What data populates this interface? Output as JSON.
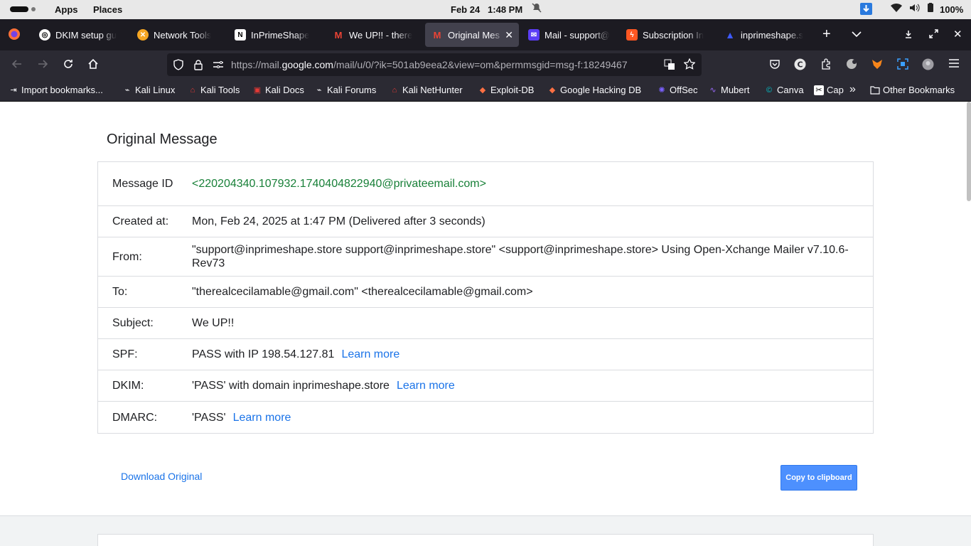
{
  "topbar": {
    "apps": "Apps",
    "places": "Places",
    "date": "Feb 24",
    "time": "1:48 PM",
    "battery": "100%"
  },
  "tabs": [
    {
      "label": "DKIM setup gu",
      "favicon": "openai-icon",
      "color": "#ffffff"
    },
    {
      "label": "Network Tools",
      "favicon": "network-tools-icon",
      "color": "#f5a623"
    },
    {
      "label": "InPrimeShape",
      "favicon": "notion-icon",
      "color": "#ffffff"
    },
    {
      "label": "We UP!! - there",
      "favicon": "gmail-icon",
      "color": "#ea4335"
    },
    {
      "label": "Original Mes",
      "favicon": "gmail-icon",
      "color": "#ea4335"
    },
    {
      "label": "Mail - support@",
      "favicon": "mail-icon",
      "color": "#5b3df5"
    },
    {
      "label": "Subscription In",
      "favicon": "subscription-icon",
      "color": "#ff5722"
    },
    {
      "label": "inprimeshape.s",
      "favicon": "triangle-icon",
      "color": "#3d5afe"
    }
  ],
  "url": {
    "prefix": "https://mail.",
    "host": "google.com",
    "rest": "/mail/u/0/?ik=501ab9eea2&view=om&permmsgid=msg-f:18249467"
  },
  "bookmarks": [
    {
      "label": "Import bookmarks...",
      "icon": "import-icon"
    },
    {
      "label": "Kali Linux",
      "icon": "kali-icon"
    },
    {
      "label": "Kali Tools",
      "icon": "kali-tools-icon"
    },
    {
      "label": "Kali Docs",
      "icon": "kali-docs-icon"
    },
    {
      "label": "Kali Forums",
      "icon": "kali-forums-icon"
    },
    {
      "label": "Kali NetHunter",
      "icon": "nethunter-icon"
    },
    {
      "label": "Exploit-DB",
      "icon": "exploit-db-icon"
    },
    {
      "label": "Google Hacking DB",
      "icon": "ghdb-icon"
    },
    {
      "label": "OffSec",
      "icon": "offsec-icon"
    },
    {
      "label": "Mubert",
      "icon": "mubert-icon"
    },
    {
      "label": "Canva",
      "icon": "canva-icon"
    },
    {
      "label": "Cap",
      "icon": "capcut-icon"
    },
    {
      "label": "Other Bookmarks",
      "icon": "folder-icon"
    }
  ],
  "page": {
    "title": "Original Message",
    "rows": {
      "message_id": {
        "key": "Message ID",
        "value": "<220204340.107932.1740404822940@privateemail.com>"
      },
      "created": {
        "key": "Created at:",
        "value": "Mon, Feb 24, 2025 at 1:47 PM (Delivered after 3 seconds)"
      },
      "from": {
        "key": "From:",
        "value": "\"support@inprimeshape.store support@inprimeshape.store\" <support@inprimeshape.store> Using Open-Xchange Mailer v7.10.6-Rev73"
      },
      "to": {
        "key": "To:",
        "value": "\"therealcecilamable@gmail.com\" <therealcecilamable@gmail.com>"
      },
      "subject": {
        "key": "Subject:",
        "value": "We UP!!"
      },
      "spf": {
        "key": "SPF:",
        "value": "PASS with IP 198.54.127.81",
        "link": "Learn more"
      },
      "dkim": {
        "key": "DKIM:",
        "value": "'PASS' with domain inprimeshape.store",
        "link": "Learn more"
      },
      "dmarc": {
        "key": "DMARC:",
        "value": "'PASS'",
        "link": "Learn more"
      }
    },
    "download_label": "Download Original",
    "copy_label": "Copy to clipboard"
  },
  "colors": {
    "link": "#1a73e8",
    "message_id": "#188038",
    "copy_button": "#4d90fe"
  }
}
